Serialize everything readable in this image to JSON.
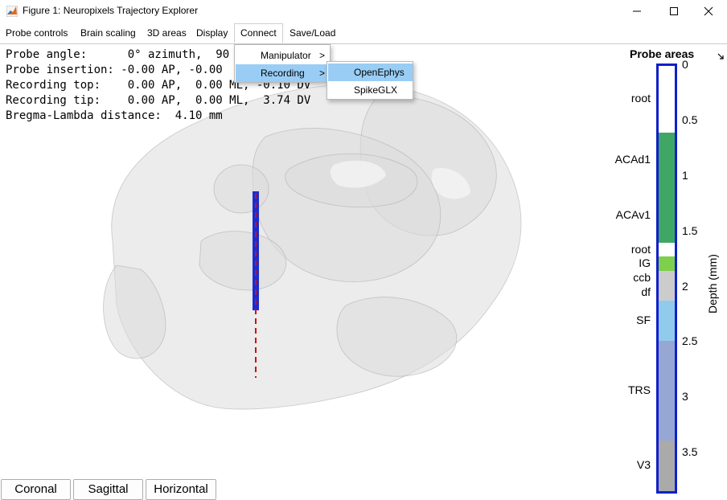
{
  "window": {
    "title": "Figure 1: Neuropixels Trajectory Explorer",
    "icon": "matlab-icon"
  },
  "menubar": {
    "items": [
      "Probe controls",
      "Brain scaling",
      "3D areas",
      "Display",
      "Connect",
      "Save/Load"
    ]
  },
  "info": {
    "lines": [
      "Probe angle:      0° azimuth,  90",
      "Probe insertion: -0.00 AP, -0.00",
      "Recording top:    0.00 AP,  0.00 ML, -0.10 DV",
      "Recording tip:    0.00 AP,  0.00 ML,  3.74 DV",
      "Bregma-Lambda distance:  4.10 mm"
    ]
  },
  "connect_menu": {
    "items": [
      "Manipulator",
      "Recording"
    ],
    "highlighted": "Recording",
    "submenu": {
      "items": [
        "OpenEphys",
        "SpikeGLX"
      ],
      "highlighted": "OpenEphys"
    }
  },
  "probe_areas": {
    "title": "Probe areas",
    "ylabel": "Depth (mm)",
    "ticks": [
      "0",
      "0.5",
      "1",
      "1.5",
      "2",
      "2.5",
      "3",
      "3.5"
    ],
    "segments": [
      {
        "name": "root",
        "start": 0.0,
        "end": 0.6,
        "color": "#ffffff"
      },
      {
        "name": "ACAd1",
        "start": 0.6,
        "end": 1.1,
        "color": "#40a666"
      },
      {
        "name": "ACAv1",
        "start": 1.1,
        "end": 1.6,
        "color": "#40a666"
      },
      {
        "name": "root",
        "start": 1.6,
        "end": 1.72,
        "color": "#ffffff"
      },
      {
        "name": "IG",
        "start": 1.72,
        "end": 1.85,
        "color": "#7ed04b"
      },
      {
        "name": "ccb",
        "start": 1.85,
        "end": 1.98,
        "color": "#cccccc"
      },
      {
        "name": "df",
        "start": 1.98,
        "end": 2.12,
        "color": "#cccccc"
      },
      {
        "name": "SF",
        "start": 2.12,
        "end": 2.48,
        "color": "#90cbed"
      },
      {
        "name": "TRS",
        "start": 2.48,
        "end": 3.38,
        "color": "#96a7d3"
      },
      {
        "name": "V3",
        "start": 3.38,
        "end": 3.84,
        "color": "#aaaaaa"
      }
    ],
    "max_depth": 3.84
  },
  "view_buttons": [
    "Coronal",
    "Sagittal",
    "Horizontal"
  ],
  "colors": {
    "probe": "#1a2cd0",
    "trajectory": "#d01010",
    "bar_border": "#1020c8",
    "menu_highlight": "#99cdf5"
  }
}
